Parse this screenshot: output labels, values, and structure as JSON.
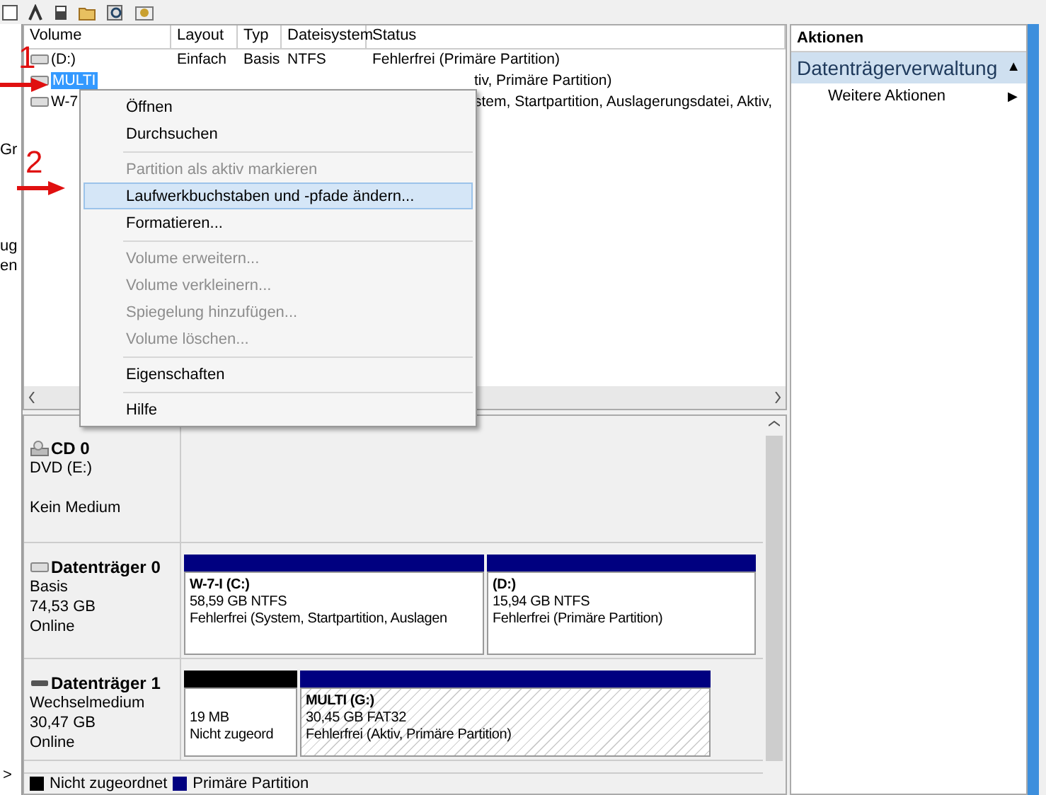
{
  "left_strip": [
    "Gr",
    "ug",
    "en"
  ],
  "table": {
    "columns": [
      "Volume",
      "Layout",
      "Typ",
      "Dateisystem",
      "Status"
    ],
    "rows": [
      {
        "cells": [
          "(D:)",
          "Einfach",
          "Basis",
          "NTFS",
          "Fehlerfrei (Primäre Partition)"
        ],
        "selected": false
      },
      {
        "cells": [
          "MULTI",
          "",
          "",
          "",
          "tiv, Primäre Partition)"
        ],
        "selected": true
      },
      {
        "cells": [
          "W-7",
          "",
          "",
          "",
          "stem, Startpartition, Auslagerungsdatei, Aktiv,"
        ],
        "selected": false
      }
    ]
  },
  "disks": [
    {
      "kind": "cd",
      "name": "CD 0",
      "lines": [
        "DVD (E:)",
        "Kein Medium"
      ]
    },
    {
      "kind": "disk",
      "name": "Datenträger 0",
      "lines": [
        "Basis",
        "74,53 GB",
        "Online"
      ],
      "partitions": [
        {
          "kind": "primary",
          "title": "W-7-I (C:)",
          "size": "58,59 GB NTFS",
          "status": "Fehlerfrei (System, Startpartition, Auslagen",
          "selected": false
        },
        {
          "kind": "primary",
          "title": "(D:)",
          "size": "15,94 GB NTFS",
          "status": "Fehlerfrei (Primäre Partition)",
          "selected": false
        }
      ]
    },
    {
      "kind": "removable",
      "name": "Datenträger 1",
      "lines": [
        "Wechselmedium",
        "30,47 GB",
        "Online"
      ],
      "partitions": [
        {
          "kind": "unallocated",
          "size": "19 MB",
          "status": "Nicht zugeord",
          "selected": false
        },
        {
          "kind": "primary",
          "title": "MULTI  (G:)",
          "size": "30,45 GB FAT32",
          "status": "Fehlerfrei (Aktiv, Primäre Partition)",
          "selected": true
        }
      ]
    }
  ],
  "legend": [
    {
      "label": "Nicht zugeordnet",
      "color": "#000000"
    },
    {
      "label": "Primäre Partition",
      "color": "#000080"
    }
  ],
  "left_nav": ">",
  "actions": {
    "header": "Aktionen",
    "section": "Datenträgerverwaltung",
    "section_toggle": "▲",
    "items": [
      {
        "label": "Weitere Aktionen",
        "arrow": "▶"
      }
    ]
  },
  "context_menu": [
    {
      "kind": "item",
      "label": "Öffnen",
      "disabled": false,
      "selected": false
    },
    {
      "kind": "item",
      "label": "Durchsuchen",
      "disabled": false,
      "selected": false
    },
    {
      "kind": "separator"
    },
    {
      "kind": "item",
      "label": "Partition als aktiv markieren",
      "disabled": true,
      "selected": false
    },
    {
      "kind": "item",
      "label": "Laufwerkbuchstaben und -pfade ändern...",
      "disabled": false,
      "selected": true
    },
    {
      "kind": "item",
      "label": "Formatieren...",
      "disabled": false,
      "selected": false
    },
    {
      "kind": "separator"
    },
    {
      "kind": "item",
      "label": "Volume erweitern...",
      "disabled": true,
      "selected": false
    },
    {
      "kind": "item",
      "label": "Volume verkleinern...",
      "disabled": true,
      "selected": false
    },
    {
      "kind": "item",
      "label": "Spiegelung hinzufügen...",
      "disabled": true,
      "selected": false
    },
    {
      "kind": "item",
      "label": "Volume löschen...",
      "disabled": true,
      "selected": false
    },
    {
      "kind": "separator"
    },
    {
      "kind": "item",
      "label": "Eigenschaften",
      "disabled": false,
      "selected": false
    },
    {
      "kind": "separator"
    },
    {
      "kind": "item",
      "label": "Hilfe",
      "disabled": false,
      "selected": false
    }
  ],
  "annotations": [
    "1",
    "2"
  ]
}
